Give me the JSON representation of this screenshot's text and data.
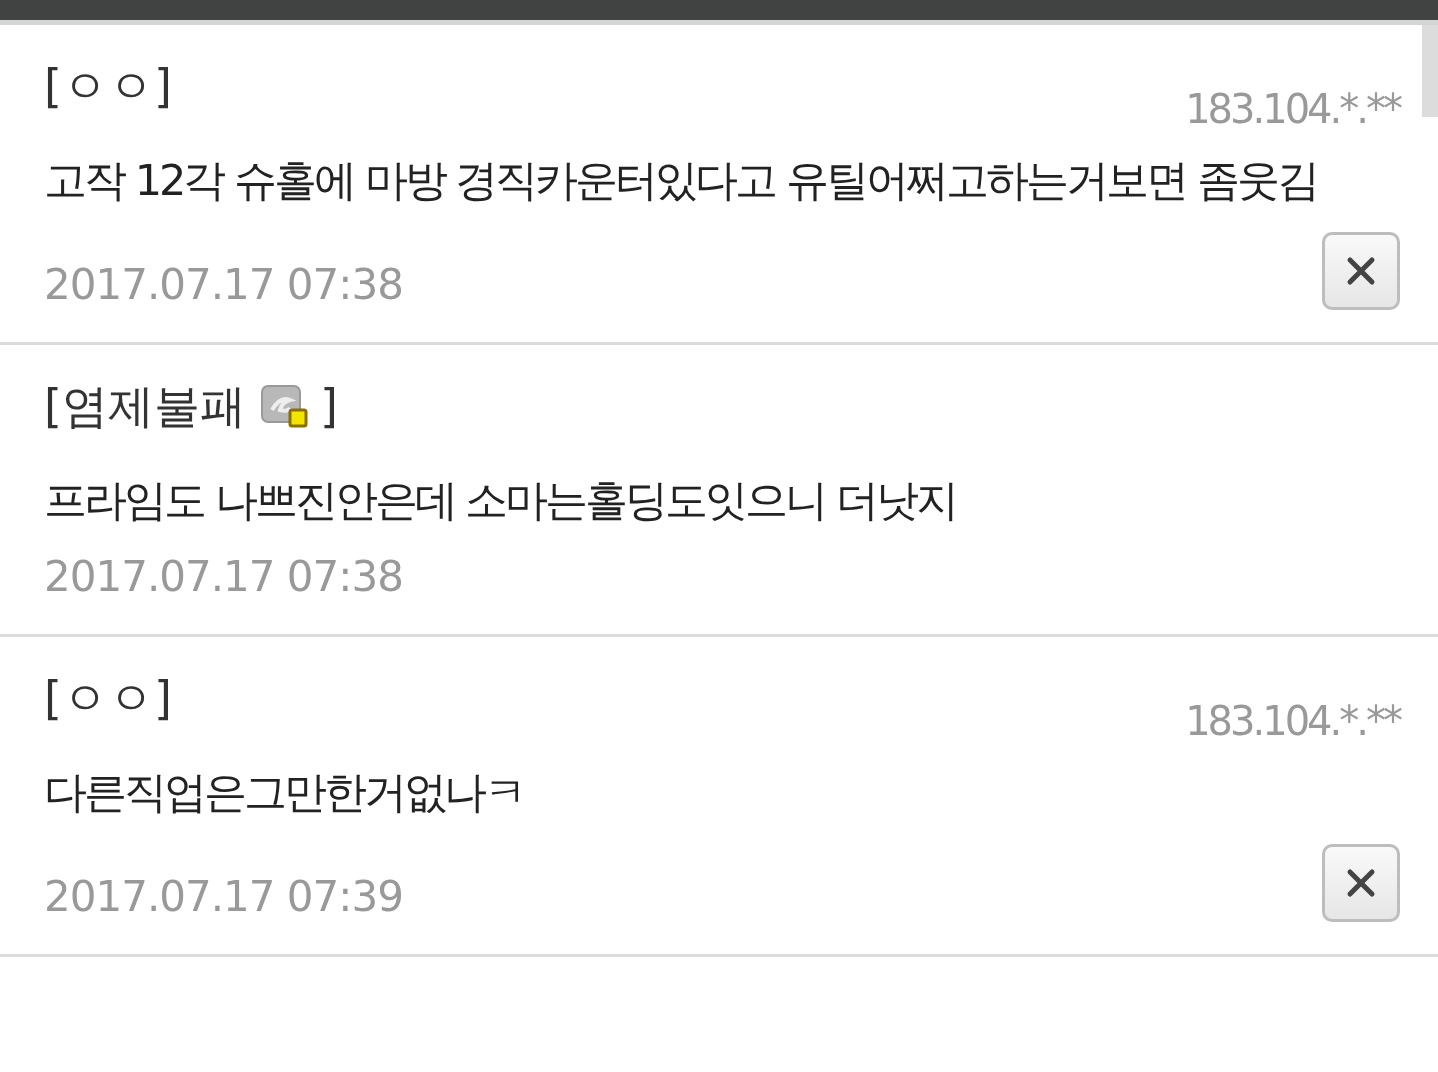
{
  "comments": [
    {
      "author": "[ㅇㅇ]",
      "member_icon": false,
      "ip": "183.104.*.**",
      "text": "고작 12각 슈홀에 마방 경직카운터있다고 유틸어쩌고하는거보면 좀웃김",
      "date": "2017.07.17 07:38",
      "deletable": true
    },
    {
      "author": "[염제불패",
      "member_icon": true,
      "author_close": "]",
      "text": "프라임도 나쁘진안은데 소마는홀딩도잇으니 더낫지",
      "date": "2017.07.17 07:38",
      "deletable": false
    },
    {
      "author": "[ㅇㅇ]",
      "member_icon": false,
      "ip": "183.104.*.**",
      "text": "다른직업은그만한거없나ㅋ",
      "date": "2017.07.17 07:39",
      "deletable": true
    }
  ]
}
